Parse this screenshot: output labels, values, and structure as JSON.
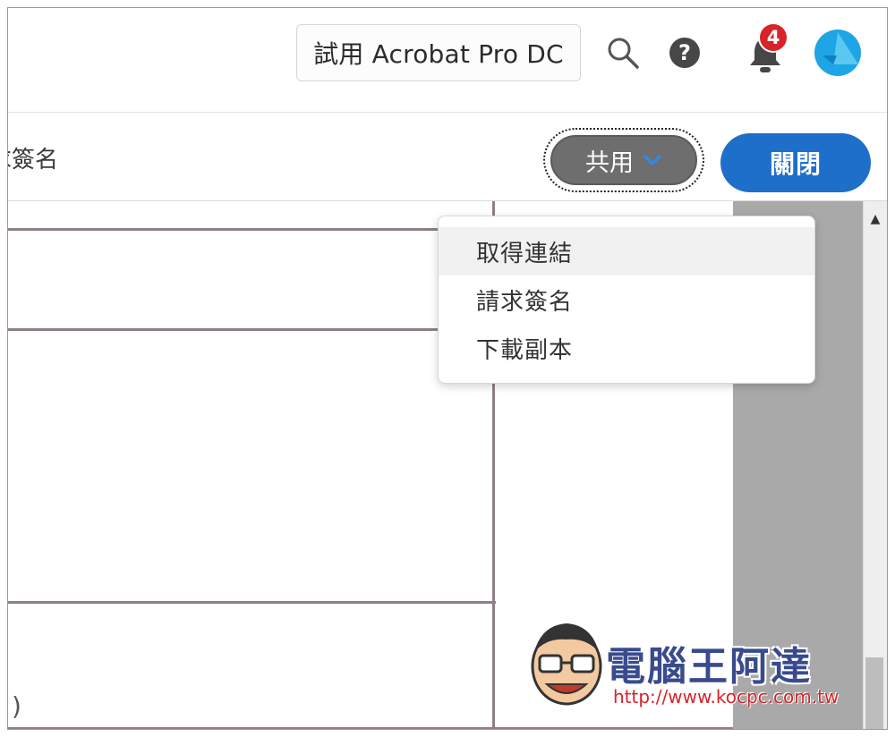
{
  "header": {
    "trial_label": "試用 Acrobat Pro DC",
    "notification_count": "4",
    "icons": [
      "search-icon",
      "help-icon",
      "bell-icon",
      "avatar"
    ]
  },
  "toolbar": {
    "doc_title": "求簽名",
    "share_label": "共用",
    "close_label": "關閉"
  },
  "share_menu": {
    "items": [
      {
        "label": "取得連結"
      },
      {
        "label": "請求簽名"
      },
      {
        "label": "下載副本"
      }
    ]
  },
  "document": {
    "fragment": ")"
  },
  "watermark": {
    "name": "電腦王阿達",
    "url": "http://www.kocpc.com.tw"
  },
  "colors": {
    "accent": "#1e6fc9",
    "share_button": "#6e6e6e",
    "badge": "#d7242b"
  }
}
